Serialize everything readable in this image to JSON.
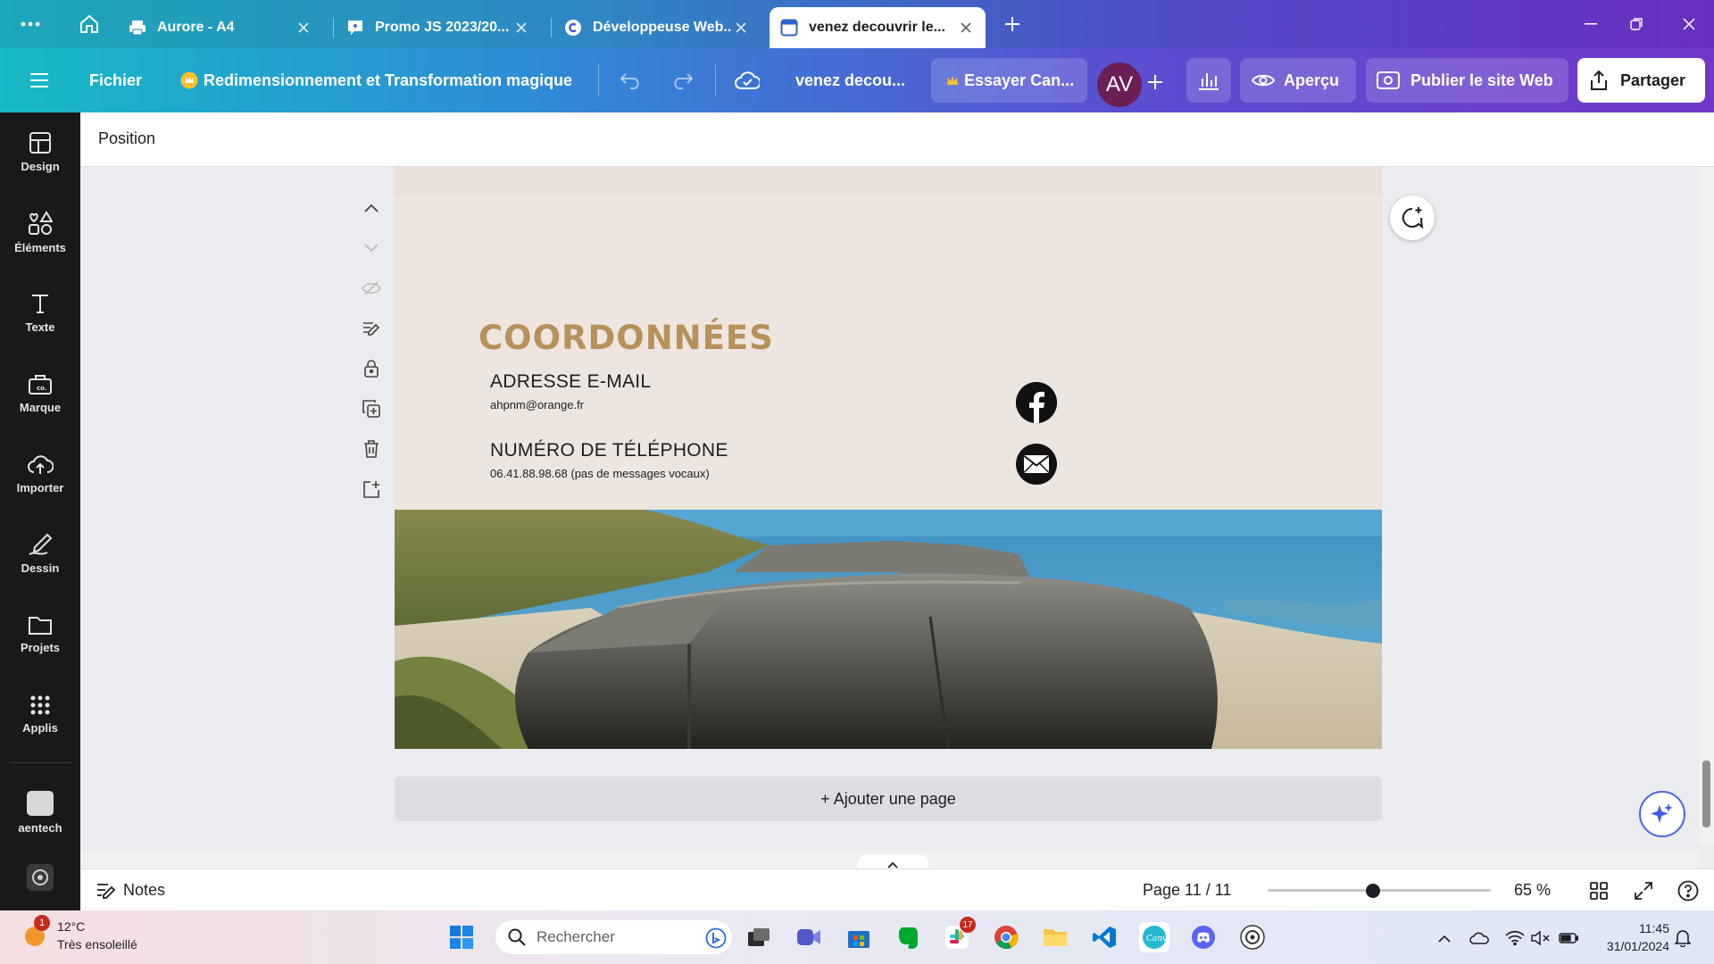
{
  "browser": {
    "tabs": [
      {
        "title": "Aurore - A4"
      },
      {
        "title": "Promo JS 2023/20..."
      },
      {
        "title": "Développeuse Web..."
      },
      {
        "title": "venez decouvrir le..."
      }
    ]
  },
  "topbar": {
    "file_label": "Fichier",
    "resize_label": "Redimensionnement et Transformation magique",
    "doc_title": "venez decou...",
    "try_label": "Essayer Can...",
    "avatar_initials": "AV",
    "preview_label": "Aperçu",
    "publish_label": "Publier le site Web",
    "share_label": "Partager"
  },
  "leftrail": {
    "items": [
      {
        "label": "Design",
        "icon": "layout-icon"
      },
      {
        "label": "Éléments",
        "icon": "shapes-icon"
      },
      {
        "label": "Texte",
        "icon": "text-icon"
      },
      {
        "label": "Marque",
        "icon": "brand-icon"
      },
      {
        "label": "Importer",
        "icon": "upload-icon"
      },
      {
        "label": "Dessin",
        "icon": "draw-icon"
      },
      {
        "label": "Projets",
        "icon": "folder-icon"
      },
      {
        "label": "Applis",
        "icon": "apps-icon"
      },
      {
        "label": "aentech",
        "icon": "app-thumbnail"
      }
    ]
  },
  "context": {
    "position_label": "Position"
  },
  "page": {
    "title": "COORDONNÉES",
    "email_label": "ADRESSE E-MAIL",
    "email_value": "ahpnm@orange.fr",
    "phone_label": "NUMÉRO DE TÉLÉPHONE",
    "phone_value": "06.41.88.98.68 (pas de messages vocaux)"
  },
  "canvas": {
    "add_page_label": "+ Ajouter une page"
  },
  "bottombar": {
    "notes_label": "Notes",
    "page_count": "Page 11 / 11",
    "zoom": "65 %",
    "zoom_fraction": 0.47
  },
  "taskbar": {
    "weather_temp": "12°C",
    "weather_desc": "Très ensoleillé",
    "weather_badge": "1",
    "search_placeholder": "Rechercher",
    "slack_badge": "17",
    "time": "11:45",
    "date": "31/01/2024"
  },
  "colors": {
    "title_gold": "#b6915a",
    "page_bg": "#ede5df",
    "rail_bg": "#18191b",
    "avatar": "#6b1f55"
  }
}
